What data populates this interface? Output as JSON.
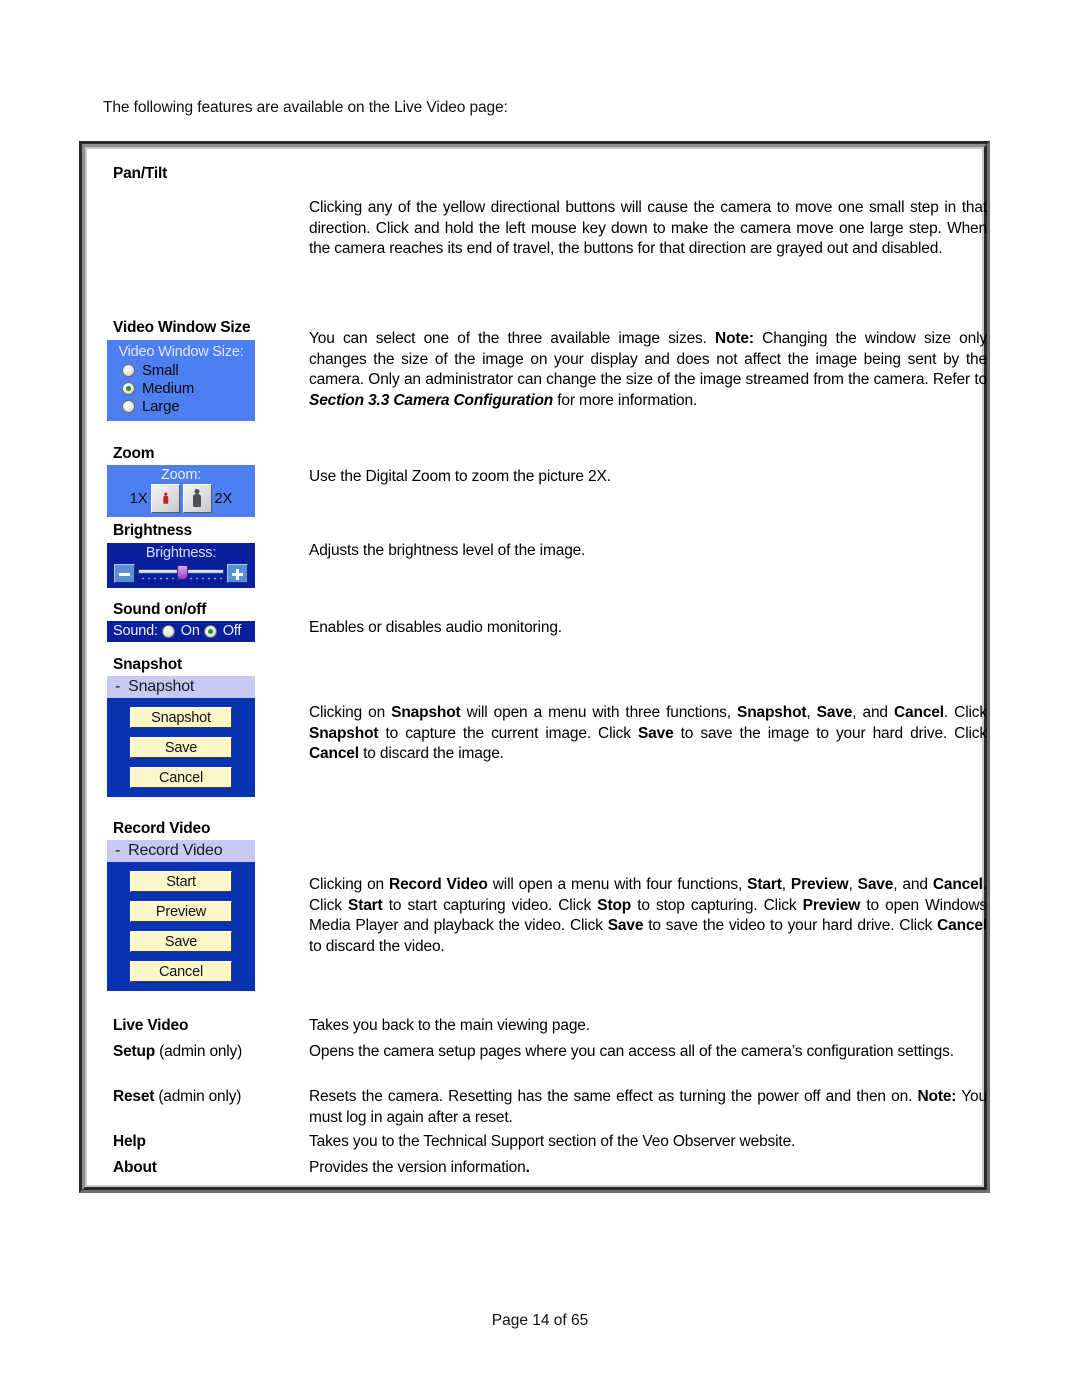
{
  "intro": "The following features are available on the Live Video page:",
  "footer": "Page 14 of 65",
  "rows": {
    "pan_tilt": {
      "label": "Pan/Tilt",
      "desc_html": "Clicking any of the yellow directional buttons will cause the camera to move one small step in that direction. Click and hold the left mouse key down to make the camera move one large step. When the camera reaches its end of travel, the buttons for that direction are grayed out and disabled."
    },
    "video_window_size": {
      "label": "Video Window Size",
      "desc_html": "You can select one of the three available image sizes. <b>Note:</b> Changing the window size only changes the size of the image on your display and does not affect the image being sent by the camera. Only an administrator can change the size of the image streamed from the camera. Refer to <i class=\"bi\">Section 3.3 Camera Configuration</i> for more information."
    },
    "zoom": {
      "label": "Zoom",
      "desc_html": "Use the Digital Zoom to zoom the picture 2X."
    },
    "brightness": {
      "label": "Brightness",
      "desc_html": "Adjusts the brightness level of the image."
    },
    "sound": {
      "label": "Sound on/off",
      "desc_html": "Enables or disables audio monitoring."
    },
    "snapshot": {
      "label": "Snapshot",
      "desc_html": "Clicking on <b>Snapshot</b> will open a menu with three functions, <b>Snapshot</b>, <b>Save</b>, and <b>Cancel</b>. Click <b>Snapshot</b> to capture the current image. Click <b>Save</b> to save the image to your hard drive. Click <b>Cancel</b> to discard the image."
    },
    "record_video": {
      "label": "Record Video",
      "desc_html": "Clicking on <b>Record Video</b> will open a menu with four functions, <b>Start</b>, <b>Preview</b>, <b>Save</b>, and <b>Cancel</b>. Click <b>Start</b> to start capturing video. Click <b>Stop</b> to stop capturing. Click <b>Preview</b> to open Windows Media Player and playback the video. Click <b>Save</b> to save the video to your hard drive. Click <b>Cancel</b> to discard the video."
    },
    "live_video": {
      "label": "Live Video",
      "desc_html": "Takes you back to the main viewing page."
    },
    "setup": {
      "label": "Setup",
      "label_suffix": " (admin only)",
      "desc_html": "Opens the camera setup pages where you can access all of the camera’s configuration settings."
    },
    "reset": {
      "label": "Reset",
      "label_suffix": " (admin only)",
      "desc_html": "Resets the camera. Resetting has the same effect as turning the power off and then on. <b>Note:</b> You must log in again after a reset."
    },
    "help": {
      "label": "Help",
      "desc_html": "Takes you to the Technical Support section of the Veo Observer website."
    },
    "about": {
      "label": "About",
      "desc_html": "Provides the version information<b>.</b>"
    }
  },
  "widgets": {
    "video_window_size": {
      "caption": "Video Window Size:",
      "options": [
        {
          "label": "Small",
          "selected": false
        },
        {
          "label": "Medium",
          "selected": true
        },
        {
          "label": "Large",
          "selected": false
        }
      ],
      "bg_color": "#4d7ff0"
    },
    "zoom": {
      "caption": "Zoom:",
      "left_label": "1X",
      "right_label": "2X",
      "bg_color": "#4d7ff0"
    },
    "brightness": {
      "caption": "Brightness:",
      "minus_label": "-",
      "plus_label": "+",
      "bg_color": "#0a1f9c",
      "thumb_color": "#9a3fc7"
    },
    "sound": {
      "caption": "Sound:",
      "options": [
        {
          "label": "On",
          "selected": false
        },
        {
          "label": "Off",
          "selected": true
        }
      ],
      "bg_color": "#0a1f9c"
    },
    "snapshot_panel": {
      "dash": "-",
      "title": "Snapshot",
      "titlebar_color": "#c6c9f2",
      "bg_color": "#0a33b2",
      "button_color": "#fdf6c9",
      "buttons": [
        "Snapshot",
        "Save",
        "Cancel"
      ]
    },
    "record_video_panel": {
      "dash": "-",
      "title": "Record Video",
      "titlebar_color": "#c6c9f2",
      "bg_color": "#0a33b2",
      "button_color": "#fdf6c9",
      "buttons": [
        "Start",
        "Preview",
        "Save",
        "Cancel"
      ]
    }
  }
}
